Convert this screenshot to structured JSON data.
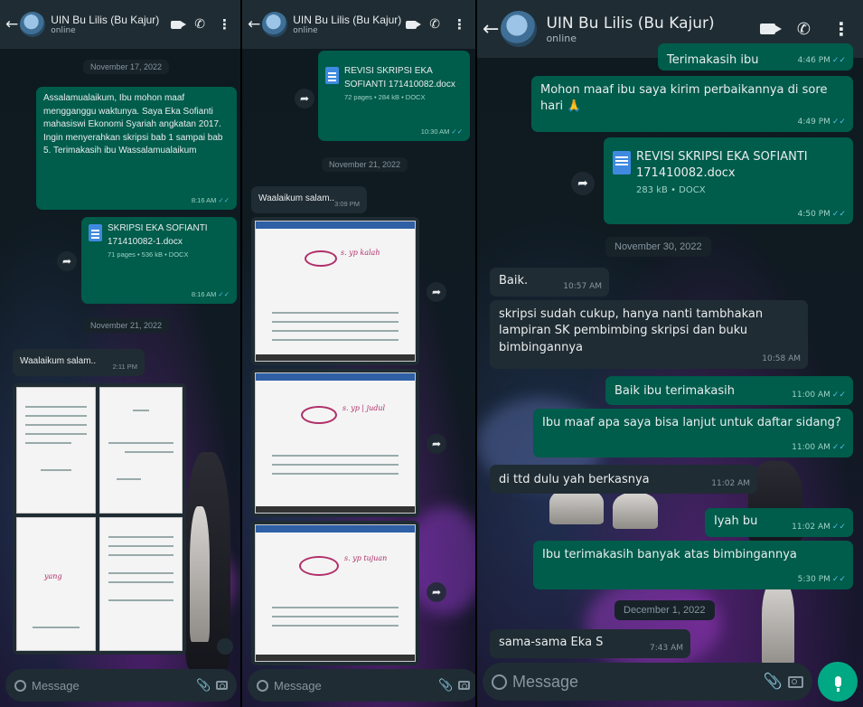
{
  "colors": {
    "header": "#1f2c33",
    "outgoing": "#005c4b",
    "incoming": "#202c33",
    "accent": "#00a884",
    "tick": "#53bdeb"
  },
  "panels": [
    {
      "header": {
        "name": "UIN Bu Lilis (Bu Kajur)",
        "status": "online",
        "back_icon": "arrow-left-icon",
        "icons": [
          "video-call-icon",
          "phone-icon",
          "more-icon"
        ]
      },
      "date1": "November 17, 2022",
      "msg1": {
        "text": "Assalamualaikum, Ibu mohon maaf mengganggu waktunya. Saya Eka Sofianti mahasiswi Ekonomi Syariah angkatan 2017. Ingin menyerahkan skripsi bab 1 sampai bab 5. Terimakasih ibu Wassalamualaikum",
        "time": "8:16 AM"
      },
      "doc1": {
        "name": "SKRIPSI EKA SOFIANTI 171410082-1.docx",
        "meta": "71 pages • 536 kB • DOCX",
        "time": "8:16 AM"
      },
      "date2": "November 21, 2022",
      "msg2": {
        "text": "Waalaikum salam..",
        "time": "2:11 PM"
      },
      "composer": {
        "placeholder": "Message"
      }
    },
    {
      "header": {
        "name": "UIN Bu Lilis (Bu Kajur)",
        "status": "online"
      },
      "doc1": {
        "name": "REVISI SKRIPSI EKA SOFIANTI 171410082.docx",
        "meta": "72 pages • 284 kB • DOCX",
        "time": "10:30 AM"
      },
      "date1": "November 21, 2022",
      "msg1": {
        "text": "Waalaikum salam..",
        "time": "3:09 PM"
      },
      "composer": {
        "placeholder": "Message"
      }
    },
    {
      "header": {
        "name": "UIN Bu Lilis (Bu Kajur)",
        "status": "online"
      },
      "msg0": {
        "text": "Terimakasih ibu",
        "time": "4:46 PM"
      },
      "msg1": {
        "text": "Mohon maaf ibu saya kirim perbaikannya di sore hari 🙏",
        "time": "4:49 PM"
      },
      "doc1": {
        "name": "REVISI SKRIPSI EKA SOFIANTI 171410082.docx",
        "meta": "283 kB • DOCX",
        "time": "4:50 PM"
      },
      "date1": "November 30, 2022",
      "msg2": {
        "text": "Baik.",
        "time": "10:57 AM"
      },
      "msg3": {
        "text": "skripsi sudah cukup, hanya nanti tambhakan lampiran SK pembimbing skripsi dan buku bimbingannya",
        "time": "10:58 AM"
      },
      "msg4": {
        "text": "Baik ibu terimakasih",
        "time": "11:00 AM"
      },
      "msg5": {
        "text": "Ibu maaf apa saya bisa lanjut untuk daftar sidang?",
        "time": "11:00 AM"
      },
      "msg6": {
        "text": "di ttd dulu yah berkasnya",
        "time": "11:02 AM"
      },
      "msg7": {
        "text": "Iyah bu",
        "time": "11:02 AM"
      },
      "msg8": {
        "text": "Ibu terimakasih banyak atas bimbingannya",
        "time": "5:30 PM"
      },
      "date2": "December 1, 2022",
      "msg9": {
        "text": "sama-sama Eka S",
        "time": "7:43 AM"
      },
      "composer": {
        "placeholder": "Message"
      }
    }
  ]
}
